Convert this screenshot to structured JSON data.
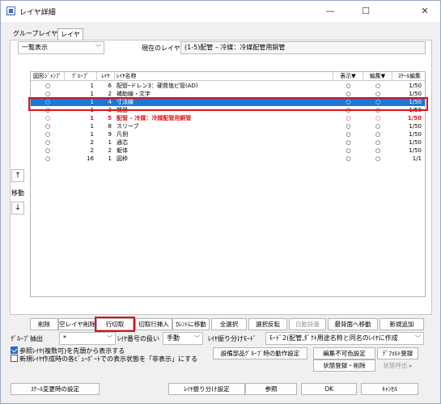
{
  "window": {
    "title": "レイヤ詳細",
    "minimize": "—",
    "maximize": "☐",
    "close": "✕"
  },
  "tabs": [
    {
      "label": "グループレイヤ"
    },
    {
      "label": "レイヤ"
    }
  ],
  "filter_combo": "一覧表示",
  "current_layer_label": "現在のレイヤ",
  "current_layer_value": "(1-5)配管 – 冷媒：冷媒配管用銅管",
  "columns": [
    "図形ｼﾞｬﾝﾌﾟ",
    "ｸﾞﾙｰﾌﾟ",
    "ﾚｲﾔ",
    "ﾚｲﾔ名称",
    "表示▼",
    "編集▼",
    "ｽｹｰﾙ編集"
  ],
  "rows": [
    {
      "fig": "○",
      "group": "1",
      "layer": "6",
      "name": "配管ｰドレン3：硬質塩ビ管(AD)",
      "disp": "○",
      "edit": "○",
      "scale": "1/50",
      "state": "normal"
    },
    {
      "fig": "○",
      "group": "1",
      "layer": "2",
      "name": "補助線・文字",
      "disp": "○",
      "edit": "○",
      "scale": "1/50",
      "state": "normal"
    },
    {
      "fig": "○",
      "group": "1",
      "layer": "4",
      "name": "寸法線",
      "disp": "○",
      "edit": "○",
      "scale": "1/50",
      "state": "selected"
    },
    {
      "fig": "○",
      "group": "1",
      "layer": "3",
      "name": "機器",
      "disp": "○",
      "edit": "○",
      "scale": "1/50",
      "state": "normal"
    },
    {
      "fig": "○",
      "group": "1",
      "layer": "5",
      "name": "配管 – 冷媒：冷媒配管用銅管",
      "disp": "○",
      "edit": "○",
      "scale": "1/50",
      "state": "current"
    },
    {
      "fig": "○",
      "group": "1",
      "layer": "8",
      "name": "スリーブ",
      "disp": "○",
      "edit": "○",
      "scale": "1/50",
      "state": "normal"
    },
    {
      "fig": "○",
      "group": "1",
      "layer": "9",
      "name": "凡例",
      "disp": "○",
      "edit": "○",
      "scale": "1/50",
      "state": "normal"
    },
    {
      "fig": "○",
      "group": "2",
      "layer": "1",
      "name": "通芯",
      "disp": "○",
      "edit": "○",
      "scale": "1/50",
      "state": "normal"
    },
    {
      "fig": "○",
      "group": "2",
      "layer": "2",
      "name": "躯体",
      "disp": "○",
      "edit": "○",
      "scale": "1/50",
      "state": "normal"
    },
    {
      "fig": "○",
      "group": "16",
      "layer": "1",
      "name": "図枠",
      "disp": "○",
      "edit": "○",
      "scale": "1/1",
      "state": "normal"
    }
  ],
  "move": {
    "up": "↑",
    "label": "移動",
    "down": "↓"
  },
  "buttons_row1": {
    "delete": "削除",
    "delete_empty": "空レイヤ削除",
    "cut_row": "行切取",
    "paste_row": "切取行挿入",
    "move_current": "ｶﾚﾝﾄに移動",
    "select_all": "全選択",
    "invert_select": "選択反転",
    "auto_sort": "自動採番",
    "move_last": "最背面へ移動",
    "add_new": "新規追加"
  },
  "group_extract_label": "ｸﾞﾙｰﾌﾟ抽出",
  "group_extract_value": "*",
  "layer_number_handling": "ﾚｲﾔ番号の扱い",
  "layer_number_mode": "手動",
  "layer_assign_mode_label": "ﾚｲﾔ振り分けﾓｰﾄﾞ",
  "layer_assign_mode": "ﾓｰﾄﾞ2(配管,ﾀﾞｸﾄ用途名称と同名のﾚｲﾔに作成",
  "check_ref_layer": "参照ﾚｲﾔ(複数可)を先頭から表示する",
  "check_new_layer_hide": "新規ﾚｲﾔ作成時の各ﾋﾞｭｰﾎﾟｰﾄでの表示状態を「非表示」にする",
  "buttons_row3": {
    "equip_group": "設備部品ｸﾞﾙｰﾌﾟ時の動作設定",
    "edit_disabled_color": "編集不可色設定",
    "default_register": "ﾃﾞﾌｫﾙﾄ登録"
  },
  "buttons_row4": {
    "state_register": "状態登録・削除",
    "state_call": "状態呼出 ▸"
  },
  "bottom": {
    "scale_change": "ｽｹｰﾙ変更時の設定",
    "layer_assign_setting": "ﾚｲﾔ振り分け設定",
    "reference": "参照",
    "ok": "OK",
    "cancel": "ｷｬﾝｾﾙ"
  },
  "colors": {
    "selection": "#1a78d6",
    "highlight_red": "#e0101a"
  }
}
